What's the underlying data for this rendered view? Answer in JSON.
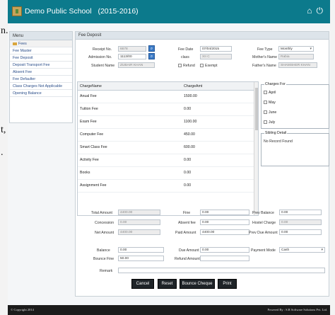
{
  "page_fragments": [
    "n.",
    "t,",
    "."
  ],
  "header": {
    "school_name": "Demo Public School",
    "session": "(2015-2016)"
  },
  "sidebar": {
    "title": "Menu",
    "items": [
      {
        "label": "Fees"
      },
      {
        "label": "Fee Master"
      },
      {
        "label": "Fee Deposit"
      },
      {
        "label": "Deposit Transport Fee"
      },
      {
        "label": "Absent Fee"
      },
      {
        "label": "Fee Defaulter"
      },
      {
        "label": "Class Charges Not Applicable"
      },
      {
        "label": "Opening Balance"
      }
    ]
  },
  "form": {
    "title": "Fee Deposit",
    "receipt_no_label": "Receipt No.",
    "receipt_no_value": "6678",
    "admission_no_label": "Admission No.",
    "admission_no_value": "1113/00",
    "student_name_label": "Student Name",
    "student_name_value": "ZUBAIR KHAN",
    "fee_date_label": "Fee Date",
    "fee_date_value": "07/04/2015",
    "class_label": "class",
    "class_value": "XII C",
    "refund_label": "Refund",
    "exempt_label": "Exempt",
    "fee_type_label": "Fee Type",
    "fee_type_value": "Monthly",
    "mother_name_label": "Mother's Name",
    "mother_name_value": "Rabia",
    "father_name_label": "Father's Name",
    "father_name_value": "SHAMSHER KHAN"
  },
  "charges": {
    "columns": [
      "ChargeName",
      "ChargeAmt"
    ],
    "rows": [
      {
        "name": "Anual Fee",
        "amount": "1500.00"
      },
      {
        "name": "Tuition Fee",
        "amount": "0.00"
      },
      {
        "name": "Exam Fee",
        "amount": "1100.00"
      },
      {
        "name": "Computer Fee",
        "amount": "450.00"
      },
      {
        "name": "Smart Class Fee",
        "amount": "600.00"
      },
      {
        "name": "Activity Fee",
        "amount": "0.00"
      },
      {
        "name": "Books",
        "amount": "0.00"
      },
      {
        "name": "Assignment Fee",
        "amount": "0.00"
      }
    ]
  },
  "charges_for": {
    "title": "Charges For",
    "months": [
      "April",
      "May",
      "June",
      "July"
    ]
  },
  "sibling": {
    "title": "Sibling Detail",
    "message": "No Record Found"
  },
  "totals": {
    "total_amount_label": "Total Amount",
    "total_amount_value": "4400.00",
    "concession_label": "Concession",
    "concession_value": "0.00",
    "net_amount_label": "Net Amount",
    "net_amount_value": "4400.00",
    "fine_label": "Fine",
    "fine_value": "0.00",
    "absent_fee_label": "Absent fee",
    "absent_fee_value": "0.00",
    "paid_amount_label": "Paid Amount",
    "paid_amount_value": "4400.00",
    "prev_balance_label": "Prev Balance",
    "prev_balance_value": "0.00",
    "hostel_charge_label": "Hostel Charge",
    "hostel_charge_value": "0.00",
    "prev_due_amount_label": "Prev Due Amount",
    "prev_due_amount_value": "0.00",
    "balance_label": "Balance",
    "balance_value": "0.00",
    "due_amount_label": "Due Amount",
    "due_amount_value": "0.00",
    "payment_mode_label": "Payment Mode",
    "payment_mode_value": "Cash",
    "bounce_fine_label": "Bounce Fine",
    "bounce_fine_value": "50.00",
    "refund_amount_label": "Refund Amount",
    "refund_amount_value": "",
    "remark_label": "Remark",
    "remark_value": ""
  },
  "buttons": {
    "cancel": "Cancel",
    "reset": "Reset",
    "bounce_cheque": "Bounce Cheque",
    "print": "Print"
  },
  "footer": {
    "copyright": "© Copyright 2014",
    "powered_by": "Powered By : S.R Software Solutions Pvt. Ltd."
  },
  "colors": {
    "topbar": "#0c7a8c",
    "link": "#2b4e8a",
    "button": "#1f2428",
    "search_button": "#3b7ac6"
  },
  "icons": [
    "search-icon",
    "home-icon",
    "power-icon",
    "folder-icon"
  ]
}
